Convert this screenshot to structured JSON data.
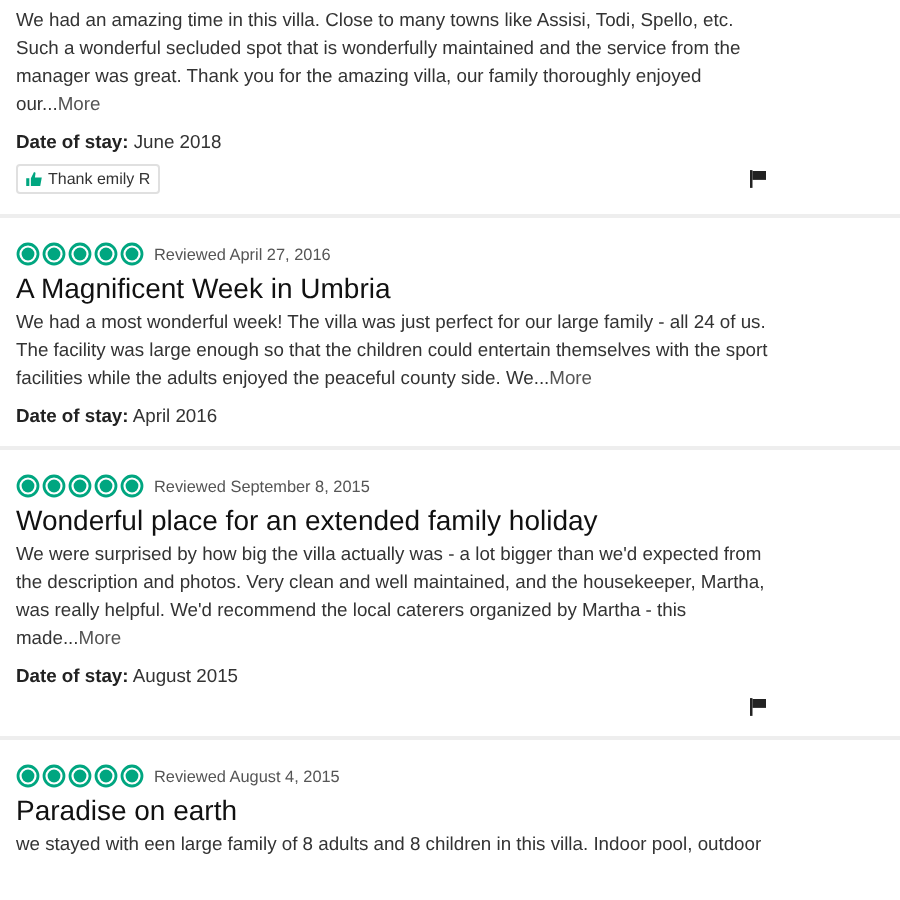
{
  "reviews": [
    {
      "body": "We had an amazing time in this villa. Close to many towns like Assisi, Todi, Spello, etc. Such a wonderful secluded spot that is wonderfully maintained and the service from the manager was great. Thank you for the amazing villa, our family thoroughly enjoyed our...",
      "more": "More",
      "date_label": "Date of stay:",
      "date": "June 2018",
      "thank": "Thank emily R",
      "flag": true
    },
    {
      "stars": 5,
      "reviewed": "Reviewed April 27, 2016",
      "title": "A Magnificent Week in Umbria",
      "body": "We had a most wonderful week! The villa was just perfect for our large family - all 24 of us. The facility was large enough so that the children could entertain themselves with the sport facilities while the adults enjoyed the peaceful county side. We...",
      "more": "More",
      "date_label": "Date of stay:",
      "date": "April 2016"
    },
    {
      "stars": 5,
      "reviewed": "Reviewed September 8, 2015",
      "title": "Wonderful place for an extended family holiday",
      "body": "We were surprised by how big the villa actually was - a lot bigger than we'd expected from the description and photos. Very clean and well maintained, and the housekeeper, Martha, was really helpful. We'd recommend the local caterers organized by Martha - this made...",
      "more": "More",
      "date_label": "Date of stay:",
      "date": "August 2015",
      "flag": true
    },
    {
      "stars": 5,
      "reviewed": "Reviewed August 4, 2015",
      "title": "Paradise on earth",
      "body": "we stayed with een large family of 8 adults and 8 children in this villa. Indoor pool, outdoor"
    }
  ]
}
